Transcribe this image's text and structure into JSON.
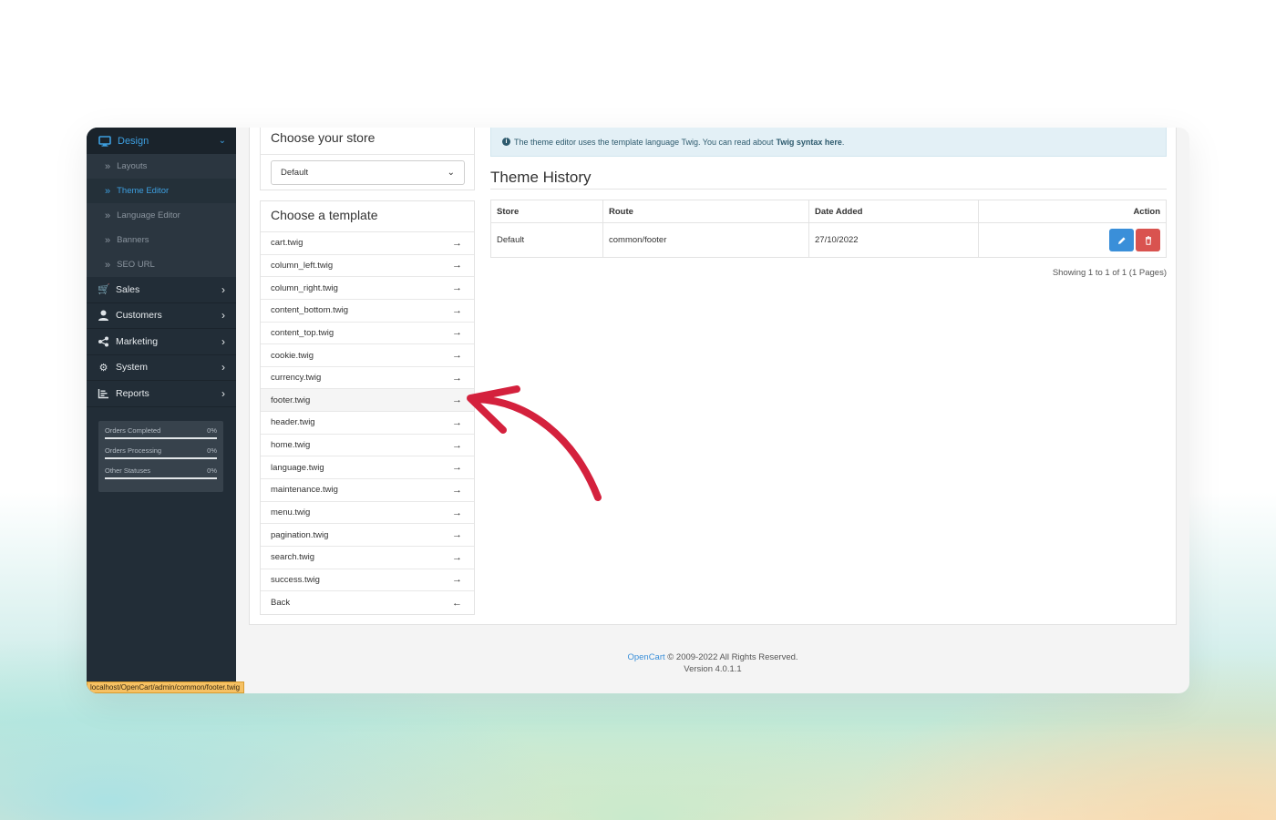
{
  "sidebar": {
    "design": {
      "label": "Design",
      "icon": "monitor-icon"
    },
    "sub_items": [
      {
        "label": "Layouts",
        "active": false
      },
      {
        "label": "Theme Editor",
        "active": true
      },
      {
        "label": "Language Editor",
        "active": false
      },
      {
        "label": "Banners",
        "active": false
      },
      {
        "label": "SEO URL",
        "active": false
      }
    ],
    "main_items": [
      {
        "label": "Sales",
        "icon": "cart-icon"
      },
      {
        "label": "Customers",
        "icon": "user-icon"
      },
      {
        "label": "Marketing",
        "icon": "share-icon"
      },
      {
        "label": "System",
        "icon": "gear-icon"
      },
      {
        "label": "Reports",
        "icon": "chart-icon"
      }
    ],
    "stats": [
      {
        "label": "Orders Completed",
        "value": "0%",
        "progress": 0
      },
      {
        "label": "Orders Processing",
        "value": "0%",
        "progress": 0
      },
      {
        "label": "Other Statuses",
        "value": "0%",
        "progress": 0
      }
    ]
  },
  "status_url": "localhost/OpenCart/admin/common/footer.twig",
  "store_panel": {
    "title": "Choose your store",
    "selected": "Default"
  },
  "template_panel": {
    "title": "Choose a template",
    "items": [
      "cart.twig",
      "column_left.twig",
      "column_right.twig",
      "content_bottom.twig",
      "content_top.twig",
      "cookie.twig",
      "currency.twig",
      "footer.twig",
      "header.twig",
      "home.twig",
      "language.twig",
      "maintenance.twig",
      "menu.twig",
      "pagination.twig",
      "search.twig",
      "success.twig"
    ],
    "back": "Back",
    "highlighted": "footer.twig"
  },
  "info": {
    "text": "The theme editor uses the template language Twig. You can read about",
    "link": "Twig syntax here",
    "end": "."
  },
  "history": {
    "title": "Theme History",
    "columns": [
      "Store",
      "Route",
      "Date Added",
      "Action"
    ],
    "rows": [
      {
        "store": "Default",
        "route": "common/footer",
        "date": "27/10/2022"
      }
    ],
    "showing": "Showing 1 to 1 of 1 (1 Pages)"
  },
  "footer": {
    "brand": "OpenCart",
    "copyright": "© 2009-2022 All Rights Reserved.",
    "version": "Version 4.0.1.1"
  },
  "colors": {
    "accent": "#3d9fe0",
    "annotation_arrow": "#d4213d",
    "delete": "#d9534f",
    "edit": "#3a8fd9"
  }
}
